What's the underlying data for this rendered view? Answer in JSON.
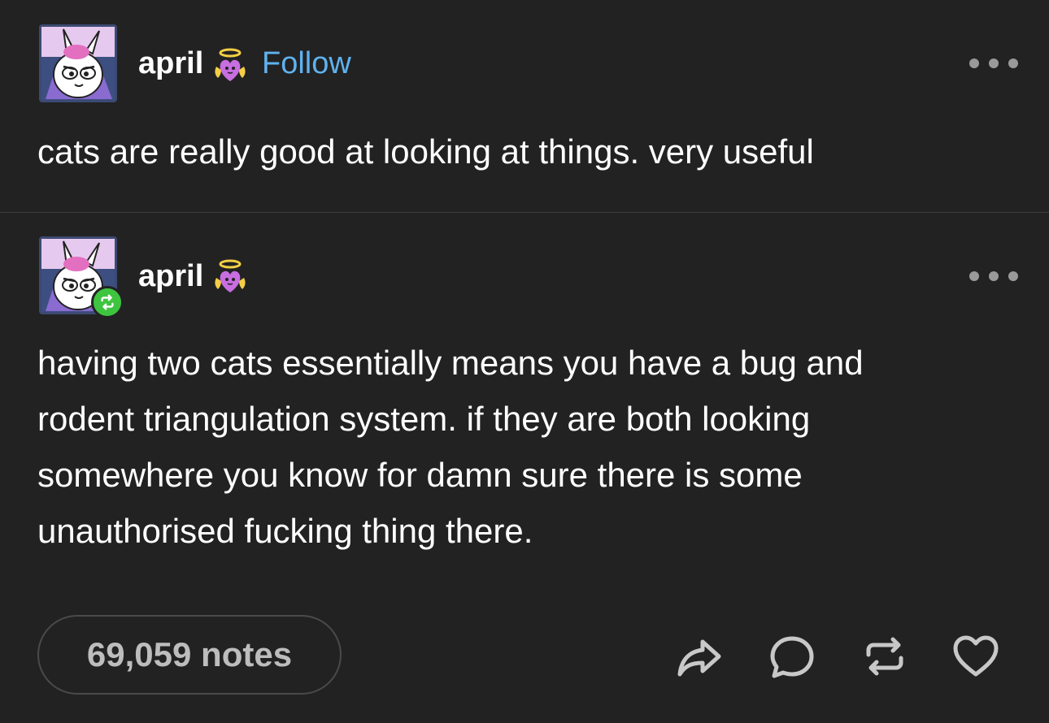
{
  "original_post": {
    "username": "april",
    "follow_label": "Follow",
    "text": "cats are really good at looking at things. very useful"
  },
  "reblog_post": {
    "username": "april",
    "text": "having two cats essentially means you have a bug and\nrodent triangulation system. if they are both looking\nsomewhere you know for damn sure there is some\nunauthorised fucking thing there."
  },
  "footer": {
    "notes_label": "69,059 notes"
  },
  "icons": {
    "more": "more-options-icon",
    "share": "share-icon",
    "reply": "reply-icon",
    "reblog": "reblog-icon",
    "like": "heart-icon",
    "reblog_badge": "reblog-badge-icon",
    "badge": "angel-heart-badge-icon"
  },
  "colors": {
    "background": "#222222",
    "text": "#ffffff",
    "follow": "#5fb2ee",
    "reblog_badge": "#3fc43f",
    "muted": "#9a9a9a"
  }
}
